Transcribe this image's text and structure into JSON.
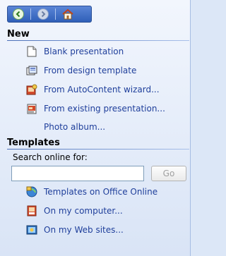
{
  "nav": {
    "back_icon": "back-arrow-icon",
    "forward_icon": "forward-arrow-icon",
    "home_icon": "home-icon"
  },
  "sections": {
    "new": {
      "title": "New",
      "items": [
        {
          "label": "Blank presentation",
          "icon": "blank-document-icon"
        },
        {
          "label": "From design template",
          "icon": "design-template-icon"
        },
        {
          "label": "From AutoContent wizard...",
          "icon": "autocontent-wizard-icon"
        },
        {
          "label": "From existing presentation...",
          "icon": "existing-presentation-icon"
        },
        {
          "label": "Photo album..."
        }
      ]
    },
    "templates": {
      "title": "Templates",
      "search_label": "Search online for:",
      "search_value": "",
      "go_label": "Go",
      "items": [
        {
          "label": "Templates on Office Online",
          "icon": "office-online-icon"
        },
        {
          "label": "On my computer...",
          "icon": "computer-templates-icon"
        },
        {
          "label": "On my Web sites...",
          "icon": "web-sites-icon"
        }
      ]
    }
  }
}
